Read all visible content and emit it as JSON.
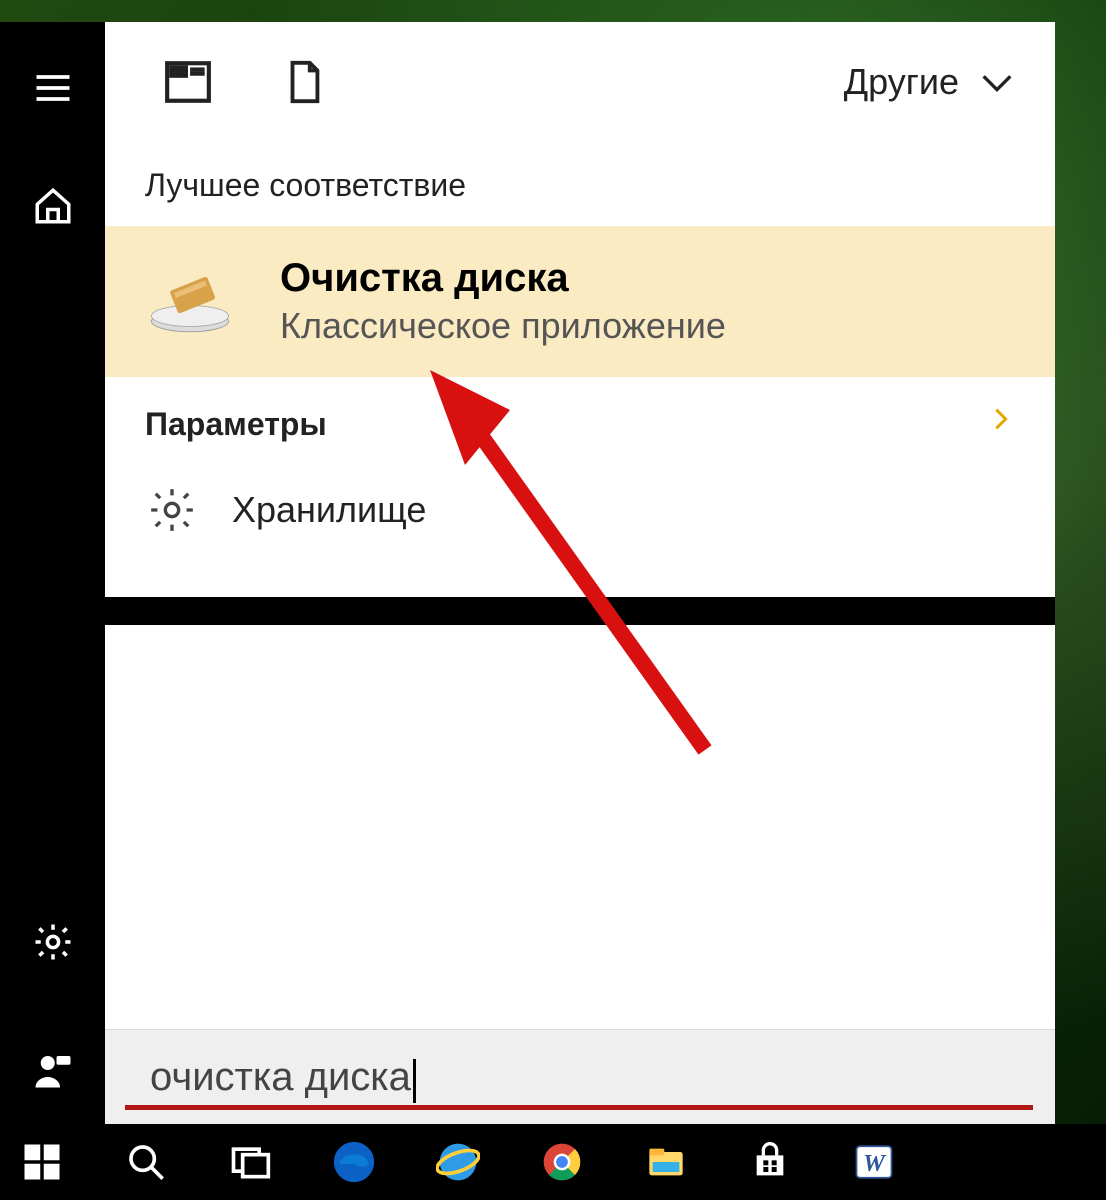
{
  "header": {
    "filter_label": "Другие"
  },
  "sections": {
    "best_match_label": "Лучшее соответствие",
    "settings_label": "Параметры"
  },
  "best_match": {
    "title": "Очистка диска",
    "subtitle": "Классическое приложение"
  },
  "settings_items": [
    {
      "label": "Хранилище"
    }
  ],
  "search": {
    "value": "очистка диска"
  },
  "icons": {
    "hamburger": "hamburger-icon",
    "home": "home-icon",
    "gear": "gear-icon",
    "user": "user-icon",
    "apps": "apps-icon",
    "document": "document-icon",
    "chevron_down": "chevron-down-icon",
    "chevron_right": "chevron-right-icon",
    "drive": "drive-icon"
  },
  "taskbar": {
    "items": [
      "start",
      "search",
      "taskview",
      "edge",
      "ie",
      "chrome",
      "explorer",
      "store",
      "word"
    ]
  }
}
